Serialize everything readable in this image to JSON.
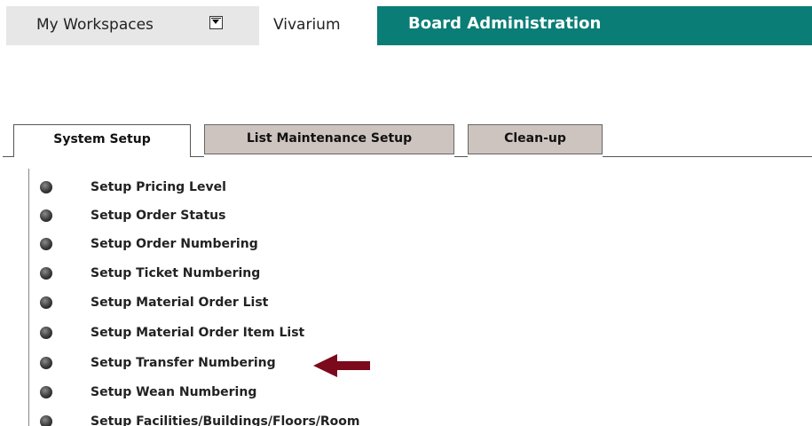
{
  "topnav": {
    "workspaces_label": "My Workspaces",
    "vivarium_label": "Vivarium",
    "board_admin_label": "Board Administration",
    "board_admin_color": "#0a7d76"
  },
  "subtabs": [
    {
      "label": "System Setup",
      "active": true
    },
    {
      "label": "List Maintenance Setup",
      "active": false
    },
    {
      "label": "Clean-up",
      "active": false
    }
  ],
  "setup_items": [
    "Setup Pricing Level",
    "Setup Order Status",
    "Setup Order Numbering",
    "Setup Ticket Numbering",
    "Setup Material Order List",
    "Setup Material Order Item List",
    "Setup Transfer Numbering",
    "Setup Wean Numbering",
    "Setup Facilities/Buildings/Floors/Room"
  ],
  "annotation": {
    "arrow_color": "#7b0a1c",
    "points_to": "Setup Transfer Numbering"
  }
}
